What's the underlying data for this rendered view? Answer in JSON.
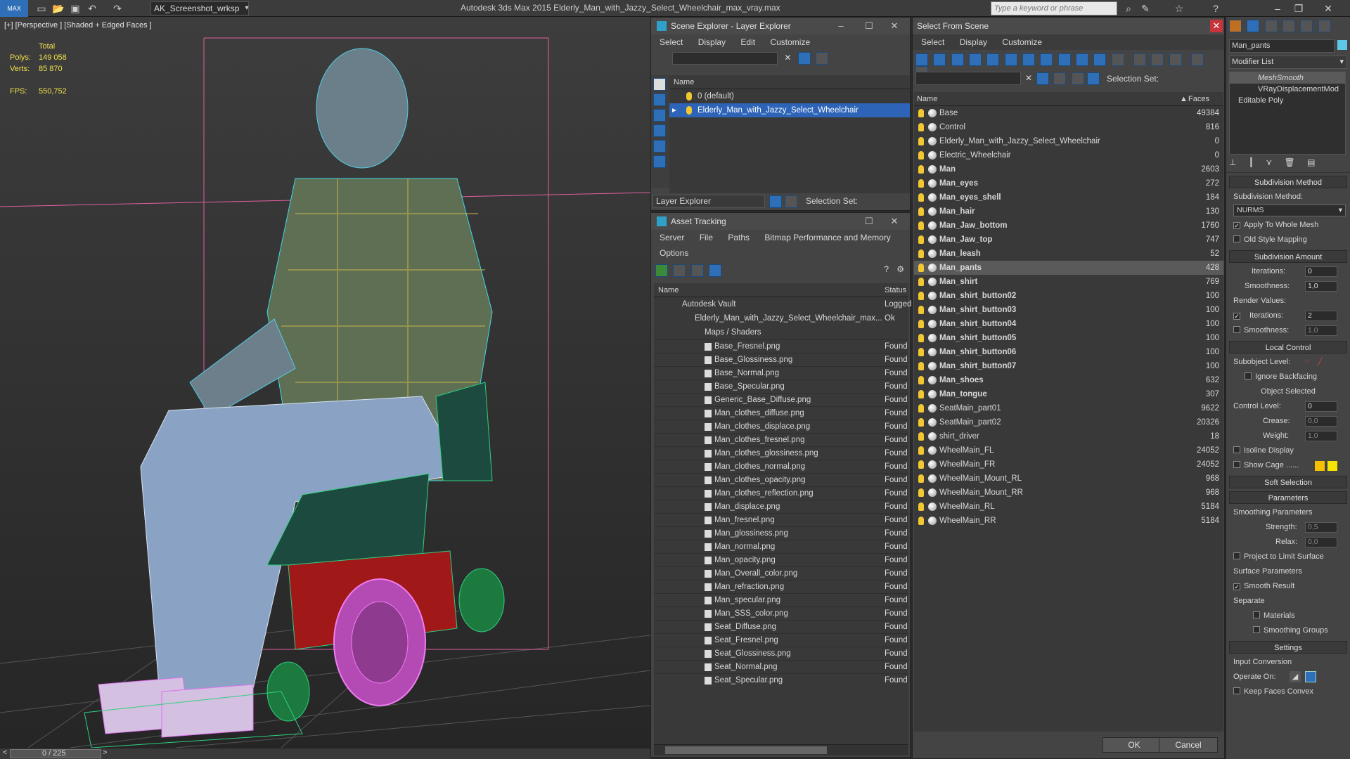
{
  "app": {
    "title": "Autodesk 3ds Max  2015    Elderly_Man_with_Jazzy_Select_Wheelchair_max_vray.max",
    "workspace": "AK_Screenshot_wrksp",
    "search_placeholder": "Type a keyword or phrase"
  },
  "viewport": {
    "label": "[+] [Perspective ] [Shaded + Edged Faces ]",
    "stats": {
      "total_label": "Total",
      "polys_label": "Polys:",
      "polys_value": "149 058",
      "verts_label": "Verts:",
      "verts_value": "85 870",
      "fps_label": "FPS:",
      "fps_value": "550,752"
    }
  },
  "timeline": {
    "frame": "0 / 225",
    "prev": "<",
    "next": ">"
  },
  "scene_explorer": {
    "title": "Scene Explorer - Layer Explorer",
    "menu": [
      "Select",
      "Display",
      "Edit",
      "Customize"
    ],
    "col_name": "Name",
    "layers": [
      "0 (default)",
      "Elderly_Man_with_Jazzy_Select_Wheelchair"
    ],
    "footer_dropdown": "Layer Explorer",
    "selection_set_label": "Selection Set:"
  },
  "asset_tracking": {
    "title": "Asset Tracking",
    "menu": [
      "Server",
      "File",
      "Paths",
      "Bitmap Performance and Memory"
    ],
    "menu2": "Options",
    "col_name": "Name",
    "col_status": "Status",
    "vault": {
      "name": "Autodesk Vault",
      "status": "Logged"
    },
    "file": {
      "name": "Elderly_Man_with_Jazzy_Select_Wheelchair_max...",
      "status": "Ok"
    },
    "folder": "Maps / Shaders",
    "maps": [
      "Base_Fresnel.png",
      "Base_Glossiness.png",
      "Base_Normal.png",
      "Base_Specular.png",
      "Generic_Base_Diffuse.png",
      "Man_clothes_diffuse.png",
      "Man_clothes_displace.png",
      "Man_clothes_fresnel.png",
      "Man_clothes_glossiness.png",
      "Man_clothes_normal.png",
      "Man_clothes_opacity.png",
      "Man_clothes_reflection.png",
      "Man_displace.png",
      "Man_fresnel.png",
      "Man_glossiness.png",
      "Man_normal.png",
      "Man_opacity.png",
      "Man_Overall_color.png",
      "Man_refraction.png",
      "Man_specular.png",
      "Man_SSS_color.png",
      "Seat_Diffuse.png",
      "Seat_Fresnel.png",
      "Seat_Glossiness.png",
      "Seat_Normal.png",
      "Seat_Specular.png"
    ],
    "found": "Found"
  },
  "select_from_scene": {
    "title": "Select From Scene",
    "menu": [
      "Select",
      "Display",
      "Customize"
    ],
    "selection_set_label": "Selection Set:",
    "col_name": "Name",
    "col_faces": "Faces",
    "items": [
      {
        "name": "Base",
        "faces": "49384",
        "bold": false
      },
      {
        "name": "Control",
        "faces": "816",
        "bold": false
      },
      {
        "name": "Elderly_Man_with_Jazzy_Select_Wheelchair",
        "faces": "0",
        "bold": false
      },
      {
        "name": "Electric_Wheelchair",
        "faces": "0",
        "bold": false
      },
      {
        "name": "Man",
        "faces": "2603",
        "bold": true
      },
      {
        "name": "Man_eyes",
        "faces": "272",
        "bold": true
      },
      {
        "name": "Man_eyes_shell",
        "faces": "184",
        "bold": true
      },
      {
        "name": "Man_hair",
        "faces": "130",
        "bold": true
      },
      {
        "name": "Man_Jaw_bottom",
        "faces": "1760",
        "bold": true
      },
      {
        "name": "Man_Jaw_top",
        "faces": "747",
        "bold": true
      },
      {
        "name": "Man_leash",
        "faces": "52",
        "bold": true
      },
      {
        "name": "Man_pants",
        "faces": "428",
        "bold": true
      },
      {
        "name": "Man_shirt",
        "faces": "769",
        "bold": true
      },
      {
        "name": "Man_shirt_button02",
        "faces": "100",
        "bold": true
      },
      {
        "name": "Man_shirt_button03",
        "faces": "100",
        "bold": true
      },
      {
        "name": "Man_shirt_button04",
        "faces": "100",
        "bold": true
      },
      {
        "name": "Man_shirt_button05",
        "faces": "100",
        "bold": true
      },
      {
        "name": "Man_shirt_button06",
        "faces": "100",
        "bold": true
      },
      {
        "name": "Man_shirt_button07",
        "faces": "100",
        "bold": true
      },
      {
        "name": "Man_shoes",
        "faces": "632",
        "bold": true
      },
      {
        "name": "Man_tongue",
        "faces": "307",
        "bold": true
      },
      {
        "name": "SeatMain_part01",
        "faces": "9622",
        "bold": false
      },
      {
        "name": "SeatMain_part02",
        "faces": "20326",
        "bold": false
      },
      {
        "name": "shirt_driver",
        "faces": "18",
        "bold": false
      },
      {
        "name": "WheelMain_FL",
        "faces": "24052",
        "bold": false
      },
      {
        "name": "WheelMain_FR",
        "faces": "24052",
        "bold": false
      },
      {
        "name": "WheelMain_Mount_RL",
        "faces": "968",
        "bold": false
      },
      {
        "name": "WheelMain_Mount_RR",
        "faces": "968",
        "bold": false
      },
      {
        "name": "WheelMain_RL",
        "faces": "5184",
        "bold": false
      },
      {
        "name": "WheelMain_RR",
        "faces": "5184",
        "bold": false
      }
    ],
    "selected": "Man_pants",
    "ok": "OK",
    "cancel": "Cancel"
  },
  "modifier_panel": {
    "object_name": "Man_pants",
    "modifier_list": "Modifier List",
    "stack": [
      "MeshSmooth",
      "VRayDisplacementMod",
      "Editable Poly"
    ],
    "subdivision_method_header": "Subdivision Method",
    "subdivision_method_label": "Subdivision Method:",
    "subdivision_method_value": "NURMS",
    "apply_whole_mesh": "Apply To Whole Mesh",
    "old_style_mapping": "Old Style Mapping",
    "subdivision_amount_header": "Subdivision Amount",
    "iterations_label": "Iterations:",
    "iterations_value": "0",
    "smoothness_label": "Smoothness:",
    "smoothness_value": "1,0",
    "render_values_label": "Render Values:",
    "render_iterations_value": "2",
    "render_smoothness_value": "1,0",
    "local_control_header": "Local Control",
    "subobject_level_label": "Subobject Level:",
    "ignore_backfacing": "Ignore Backfacing",
    "object_selected": "Object Selected",
    "control_level_label": "Control Level:",
    "control_level_value": "0",
    "crease_label": "Crease:",
    "crease_value": "0,0",
    "weight_label": "Weight:",
    "weight_value": "1,0",
    "isoline_display": "Isoline Display",
    "show_cage": "Show Cage ......",
    "soft_selection_header": "Soft Selection",
    "parameters_header": "Parameters",
    "smoothing_params": "Smoothing Parameters",
    "strength_label": "Strength:",
    "strength_value": "0,5",
    "relax_label": "Relax:",
    "relax_value": "0,0",
    "project_limit": "Project to Limit Surface",
    "surface_params": "Surface Parameters",
    "smooth_result": "Smooth Result",
    "separate": "Separate",
    "materials": "Materials",
    "smoothing_groups": "Smoothing Groups",
    "settings_header": "Settings",
    "input_conversion": "Input Conversion",
    "operate_on": "Operate On:",
    "keep_faces_convex": "Keep Faces Convex"
  }
}
